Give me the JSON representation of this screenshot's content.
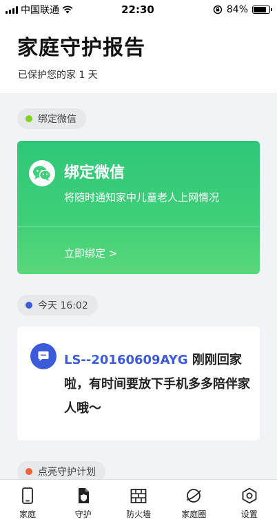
{
  "status_bar": {
    "carrier": "中国联通",
    "time": "22:30",
    "battery": "84%",
    "battery_level": 0.84
  },
  "header": {
    "title": "家庭守护报告",
    "subtitle": "已保护您的家 1 天"
  },
  "sections": {
    "wechat_chip": {
      "label": "绑定微信",
      "dot_color": "#7ed321"
    },
    "today_chip": {
      "label": "今天 16:02",
      "dot_color": "#3b5bdb"
    },
    "plan_chip": {
      "label": "点亮守护计划",
      "dot_color": "#f0633a"
    }
  },
  "wechat_card": {
    "title": "绑定微信",
    "description": "将随时通知家中儿童老人上网情况",
    "action": "立即绑定 >"
  },
  "message_card": {
    "device": "LS--20160609AYG",
    "text": " 刚刚回家啦，有时间要放下手机多多陪伴家人哦～"
  },
  "tabs": [
    {
      "label": "家庭",
      "icon": "phone-icon"
    },
    {
      "label": "守护",
      "icon": "shield-document-icon"
    },
    {
      "label": "防火墙",
      "icon": "firewall-icon"
    },
    {
      "label": "家庭圈",
      "icon": "planet-icon"
    },
    {
      "label": "设置",
      "icon": "hexagon-settings-icon"
    }
  ],
  "colors": {
    "wechat_green": "#2ec779",
    "accent_blue": "#3b5bdb"
  }
}
